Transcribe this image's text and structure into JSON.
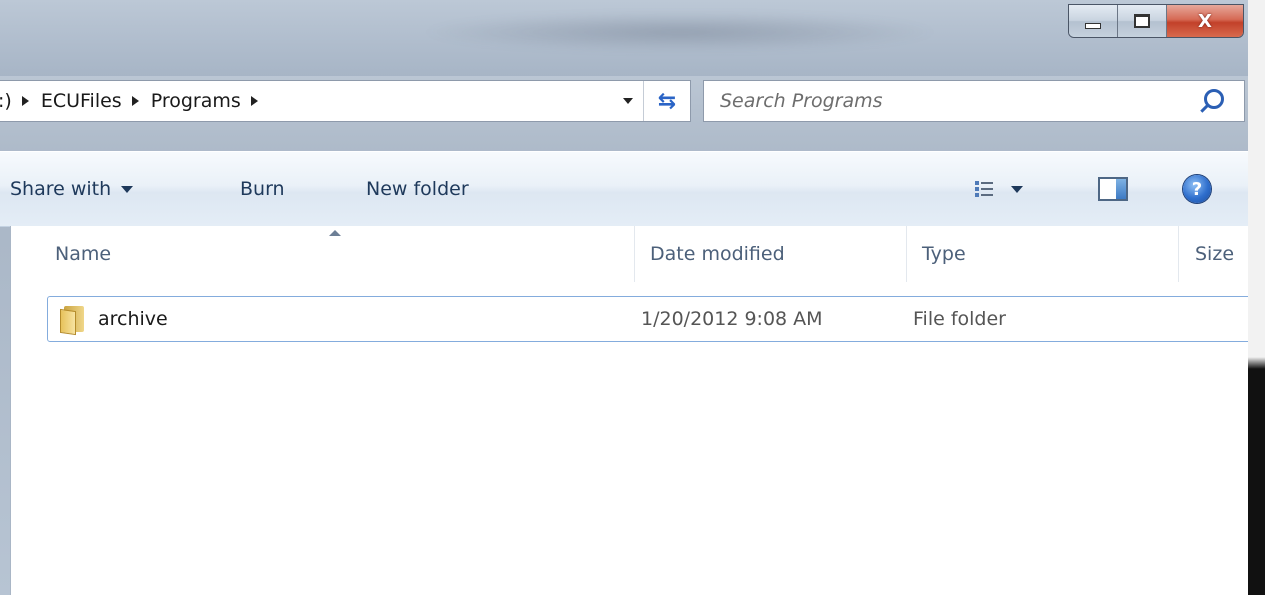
{
  "window": {
    "caption": {
      "minimize_glyph": "",
      "maximize_glyph": "",
      "close_glyph": "X"
    }
  },
  "address": {
    "crumbs": [
      ":)",
      "ECUFiles",
      "Programs"
    ],
    "refresh_icon": "back-forward-icon"
  },
  "search": {
    "placeholder": "Search Programs",
    "icon": "search-icon"
  },
  "toolbar": {
    "share_label": "Share with",
    "burn_label": "Burn",
    "new_folder_label": "New folder",
    "views_icon": "views-icon",
    "preview_icon": "preview-pane-icon",
    "help_icon": "help-icon",
    "help_glyph": "?"
  },
  "columns": {
    "name": "Name",
    "date_modified": "Date modified",
    "type": "Type",
    "size": "Size"
  },
  "files": [
    {
      "name": "archive",
      "date_modified": "1/20/2012 9:08 AM",
      "type": "File folder",
      "size": "",
      "icon": "folder-icon"
    }
  ],
  "colors": {
    "toolbar_text": "#1e395b",
    "header_text": "#4c607a",
    "selection_border": "#84acdd",
    "close_button": "#c2412a"
  }
}
